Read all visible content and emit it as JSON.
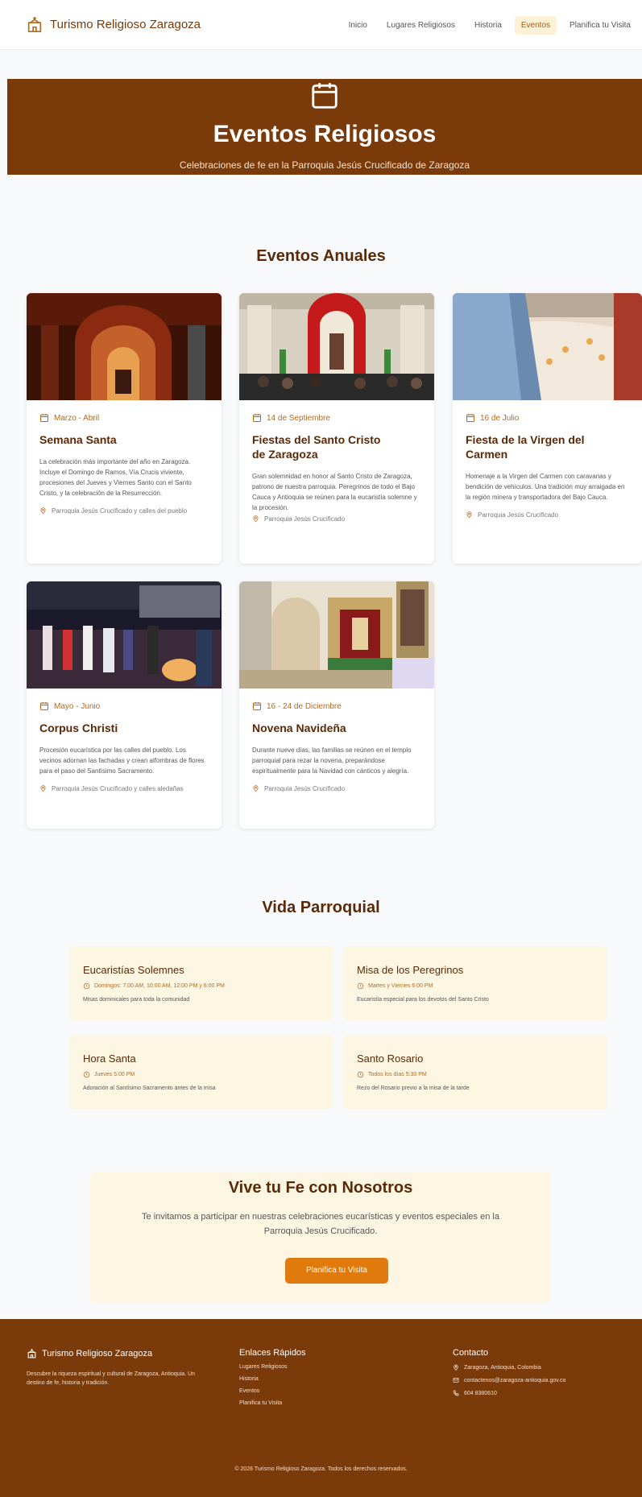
{
  "nav": {
    "brand": "Turismo Religioso Zaragoza",
    "links": [
      "Inicio",
      "Lugares Religiosos",
      "Historia",
      "Eventos",
      "Planifica tu Visita"
    ]
  },
  "hero": {
    "title": "Eventos Religiosos",
    "subtitle": "Celebraciones de fe en la Parroquia Jesús Crucificado de Zaragoza"
  },
  "annual": {
    "title": "Eventos Anuales",
    "events": [
      {
        "date": "Marzo - Abril",
        "title": "Semana Santa",
        "description": "La celebración más importante del año en Zaragoza. Incluye el Domingo de Ramos, Vía Crucis viviente, procesiones del Jueves y Viernes Santo con el Santo Cristo, y la celebración de la Resurrección.",
        "location": "Parroquia Jesús Crucificado y calles del pueblo"
      },
      {
        "date": "14 de Septiembre",
        "title": "Fiestas del Santo Cristo de Zaragoza",
        "description": "Gran solemnidad en honor al Santo Cristo de Zaragoza, patrono de nuestra parroquia. Peregrinos de todo el Bajo Cauca y Antioquia se reúnen para la eucaristía solemne y la procesión.",
        "location": "Parroquia Jesús Crucificado"
      },
      {
        "date": "16 de Julio",
        "title": "Fiesta de la Virgen del Carmen",
        "description": "Homenaje a la Virgen del Carmen con caravanas y bendición de vehículos. Una tradición muy arraigada en la región minera y transportadora del Bajo Cauca.",
        "location": "Parroquia Jesús Crucificado"
      },
      {
        "date": "Mayo - Junio",
        "title": "Corpus Christi",
        "description": "Procesión eucarística por las calles del pueblo. Los vecinos adornan las fachadas y crean alfombras de flores para el paso del Santísimo Sacramento.",
        "location": "Parroquia Jesús Crucificado y calles aledañas"
      },
      {
        "date": "16 - 24 de Diciembre",
        "title": "Novena Navideña",
        "description": "Durante nueve días, las familias se reúnen en el templo parroquial para rezar la novena, preparándose espiritualmente para la Navidad con cánticos y alegría.",
        "location": "Parroquia Jesús Crucificado"
      }
    ]
  },
  "parish": {
    "title": "Vida Parroquial",
    "items": [
      {
        "title": "Eucaristías Solemnes",
        "time": "Domingos: 7:00 AM, 10:00 AM, 12:00 PM y 6:00 PM",
        "description": "Misas dominicales para toda la comunidad"
      },
      {
        "title": "Misa de los Peregrinos",
        "time": "Martes y Viernes 6:00 PM",
        "description": "Eucaristía especial para los devotos del Santo Cristo"
      },
      {
        "title": "Hora Santa",
        "time": "Jueves 5:00 PM",
        "description": "Adoración al Santísimo Sacramento antes de la misa"
      },
      {
        "title": "Santo Rosario",
        "time": "Todos los días 5:30 PM",
        "description": "Rezo del Rosario previo a la misa de la tarde"
      }
    ]
  },
  "cta": {
    "title": "Vive tu Fe con Nosotros",
    "text": "Te invitamos a participar en nuestras celebraciones eucarísticas y eventos especiales en la Parroquia Jesús Crucificado.",
    "button": "Planifica tu Visita"
  },
  "footer": {
    "brand": "Turismo Religioso Zaragoza",
    "about": "Descubre la riqueza espiritual y cultural de Zaragoza, Antioquia. Un destino de fe, historia y tradición.",
    "links_title": "Enlaces Rápidos",
    "links": [
      "Lugares Religiosos",
      "Historia",
      "Eventos",
      "Planifica tu Visita"
    ],
    "contact_title": "Contacto",
    "contact": {
      "location": "Zaragoza, Antioquia, Colombia",
      "email": "contactenos@zaragoza-antioquia.gov.co",
      "phone": "604 8380610"
    },
    "copyright": "© 2026 Turismo Religioso Zaragoza. Todos los derechos reservados."
  },
  "colors": {
    "brand_brown": "#7b3a0a",
    "accent_orange": "#e07a0d",
    "cream": "#fdf6e3"
  },
  "icons": {
    "brand": "church-icon",
    "hero": "calendar-icon",
    "date": "calendar-icon",
    "location": "map-pin-icon",
    "time": "clock-icon"
  }
}
